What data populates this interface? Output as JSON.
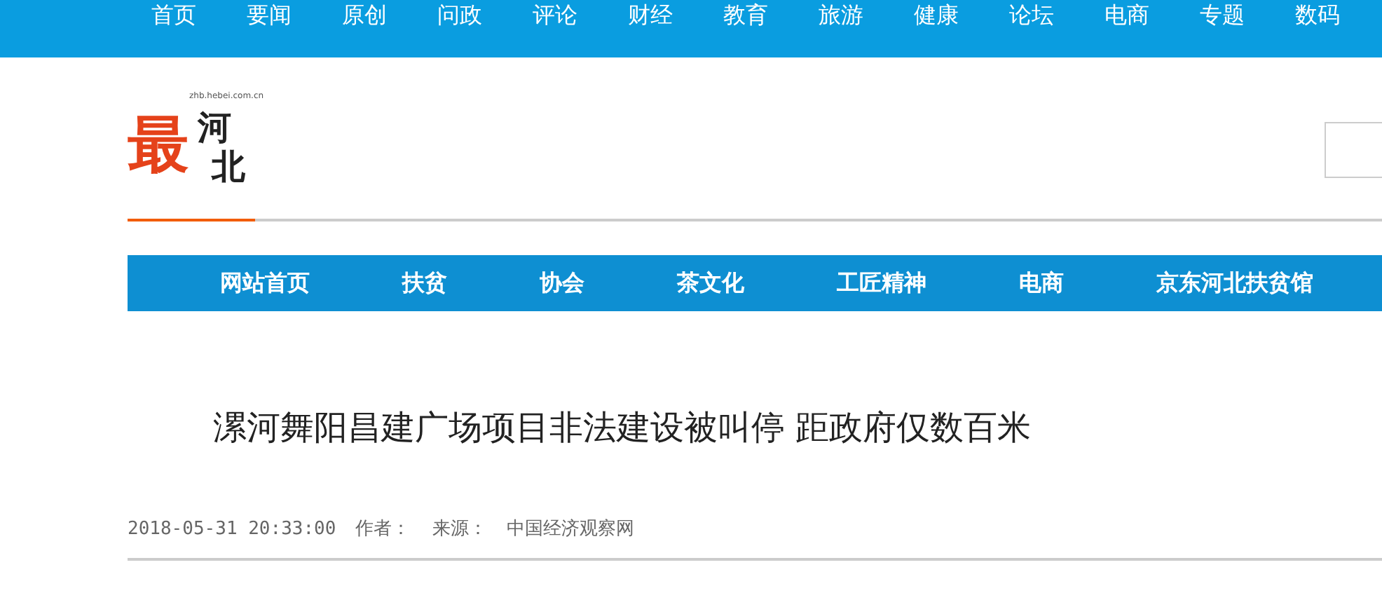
{
  "top_nav": [
    "首页",
    "要闻",
    "原创",
    "问政",
    "评论",
    "财经",
    "教育",
    "旅游",
    "健康",
    "论坛",
    "电商",
    "专题",
    "数码"
  ],
  "logo": {
    "mark": "最",
    "name_1": "河",
    "name_2": "北",
    "domain": "zhb.hebei.com.cn"
  },
  "channel_nav": [
    "网站首页",
    "扶贫",
    "协会",
    "茶文化",
    "工匠精神",
    "电商",
    "京东河北扶贫馆"
  ],
  "article": {
    "title": "漯河舞阳昌建广场项目非法建设被叫停 距政府仅数百米",
    "date": "2018-05-31 20:33:00",
    "author_label": "作者：",
    "source_label": "来源：",
    "source": "中国经济观察网"
  }
}
